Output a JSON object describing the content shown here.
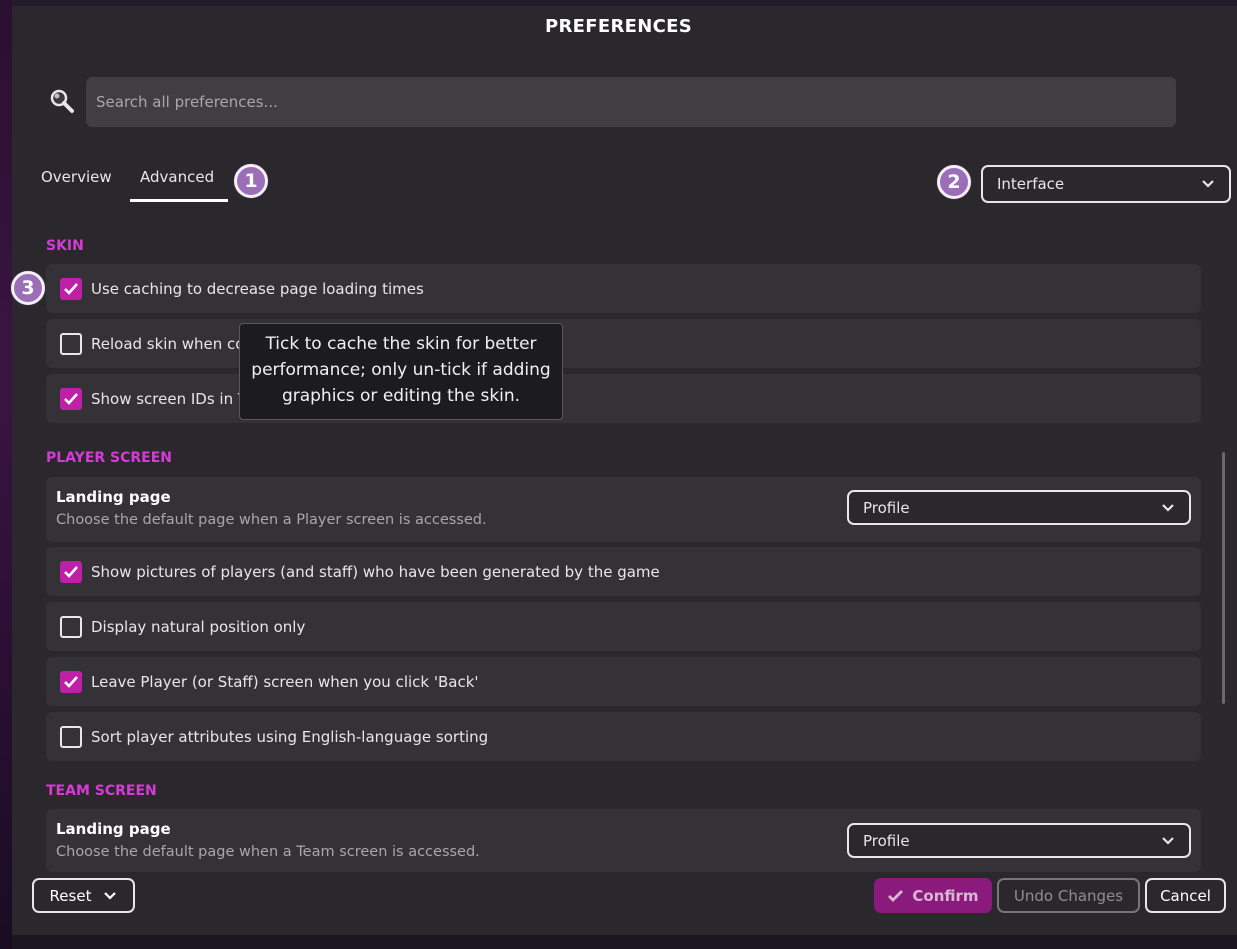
{
  "title": "PREFERENCES",
  "search": {
    "placeholder": "Search all preferences..."
  },
  "tabs": [
    {
      "label": "Overview",
      "active": false
    },
    {
      "label": "Advanced",
      "active": true
    }
  ],
  "badges": [
    "1",
    "2",
    "3"
  ],
  "category_select": {
    "value": "Interface"
  },
  "sections": {
    "skin": {
      "title": "SKIN",
      "items": [
        {
          "label": "Use caching to decrease page loading times",
          "checked": true
        },
        {
          "label": "Reload skin when co",
          "checked": false
        },
        {
          "label": "Show screen IDs in T",
          "checked": true
        }
      ]
    },
    "player": {
      "title": "PLAYER SCREEN",
      "landing": {
        "title": "Landing page",
        "desc": "Choose the default page when a Player screen is accessed.",
        "value": "Profile"
      },
      "items": [
        {
          "label": "Show pictures of players (and staff) who have been generated by the game",
          "checked": true
        },
        {
          "label": "Display natural position only",
          "checked": false
        },
        {
          "label": "Leave Player (or Staff) screen when you click 'Back'",
          "checked": true
        },
        {
          "label": "Sort player attributes using English-language sorting",
          "checked": false
        }
      ]
    },
    "team": {
      "title": "TEAM SCREEN",
      "landing": {
        "title": "Landing page",
        "desc": "Choose the default page when a Team screen is accessed.",
        "value": "Profile"
      }
    }
  },
  "tooltip": {
    "line1": "Tick to cache the skin for better",
    "line2": "performance; only un-tick if adding",
    "line3": "graphics or editing the skin."
  },
  "footer": {
    "reset": "Reset",
    "confirm": "Confirm",
    "undo": "Undo Changes",
    "cancel": "Cancel"
  },
  "colors": {
    "accent": "#d63bd6",
    "checkbox": "#c01fa8",
    "badge": "#9a6fb8",
    "confirm": "#8a1a7c"
  }
}
